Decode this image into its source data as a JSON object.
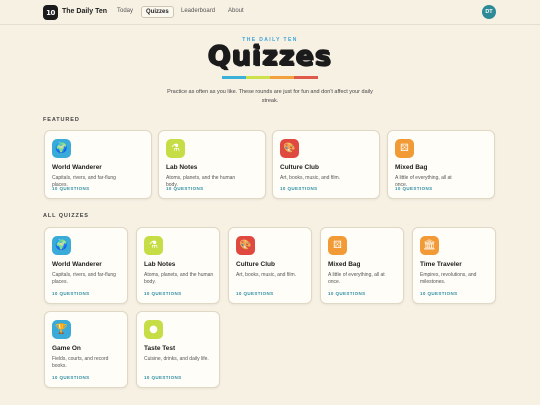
{
  "nav": {
    "logo_text": "10",
    "brand": "The Daily Ten",
    "links": [
      "Today",
      "Quizzes",
      "Leaderboard",
      "About"
    ],
    "active_link": "Quizzes",
    "avatar_initials": "DT"
  },
  "hero": {
    "kicker": "THE DAILY TEN",
    "title": "Quizzes",
    "stripe_colors": [
      "#3bb0d8",
      "#cde24a",
      "#f2a23c",
      "#e05a4c"
    ],
    "subtitle": "Practice as often as you like. These rounds are just for fun and don't affect your daily streak."
  },
  "featured": {
    "label": "FEATURED",
    "cards": [
      {
        "title": "World Wanderer",
        "desc": "Capitals, rivers, and far-flung places.",
        "meta": "10 QUESTIONS",
        "icon": "globe-icon",
        "glyph": "🌍",
        "color": "#3aaad8"
      },
      {
        "title": "Lab Notes",
        "desc": "Atoms, planets, and the human body.",
        "meta": "10 QUESTIONS",
        "icon": "flask-icon",
        "glyph": "⚗",
        "color": "#c6dd45"
      },
      {
        "title": "Culture Club",
        "desc": "Art, books, music, and film.",
        "meta": "10 QUESTIONS",
        "icon": "palette-icon",
        "glyph": "🎨",
        "color": "#e0493f"
      },
      {
        "title": "Mixed Bag",
        "desc": "A little of everything, all at once.",
        "meta": "10 QUESTIONS",
        "icon": "dice-icon",
        "glyph": "⚄",
        "color": "#f29a35"
      }
    ]
  },
  "all": {
    "label": "ALL QUIZZES",
    "cards": [
      {
        "title": "World Wanderer",
        "desc": "Capitals, rivers, and far-flung places.",
        "meta": "10 QUESTIONS",
        "icon": "globe-icon",
        "glyph": "🌍",
        "color": "#3aaad8"
      },
      {
        "title": "Lab Notes",
        "desc": "Atoms, planets, and the human body.",
        "meta": "10 QUESTIONS",
        "icon": "flask-icon",
        "glyph": "⚗",
        "color": "#c6dd45"
      },
      {
        "title": "Culture Club",
        "desc": "Art, books, music, and film.",
        "meta": "10 QUESTIONS",
        "icon": "palette-icon",
        "glyph": "🎨",
        "color": "#e0493f"
      },
      {
        "title": "Mixed Bag",
        "desc": "A little of everything, all at once.",
        "meta": "10 QUESTIONS",
        "icon": "dice-icon",
        "glyph": "⚄",
        "color": "#f29a35"
      },
      {
        "title": "Time Traveler",
        "desc": "Empires, revolutions, and milestones.",
        "meta": "10 QUESTIONS",
        "icon": "columns-icon",
        "glyph": "🏛",
        "color": "#f29a35"
      },
      {
        "title": "Game On",
        "desc": "Fields, courts, and record books.",
        "meta": "10 QUESTIONS",
        "icon": "trophy-icon",
        "glyph": "🏆",
        "color": "#3aaad8"
      },
      {
        "title": "Taste Test",
        "desc": "Cuisine, drinks, and daily life.",
        "meta": "10 QUESTIONS",
        "icon": "plate-icon",
        "glyph": "●",
        "color": "#c6dd45"
      }
    ]
  }
}
